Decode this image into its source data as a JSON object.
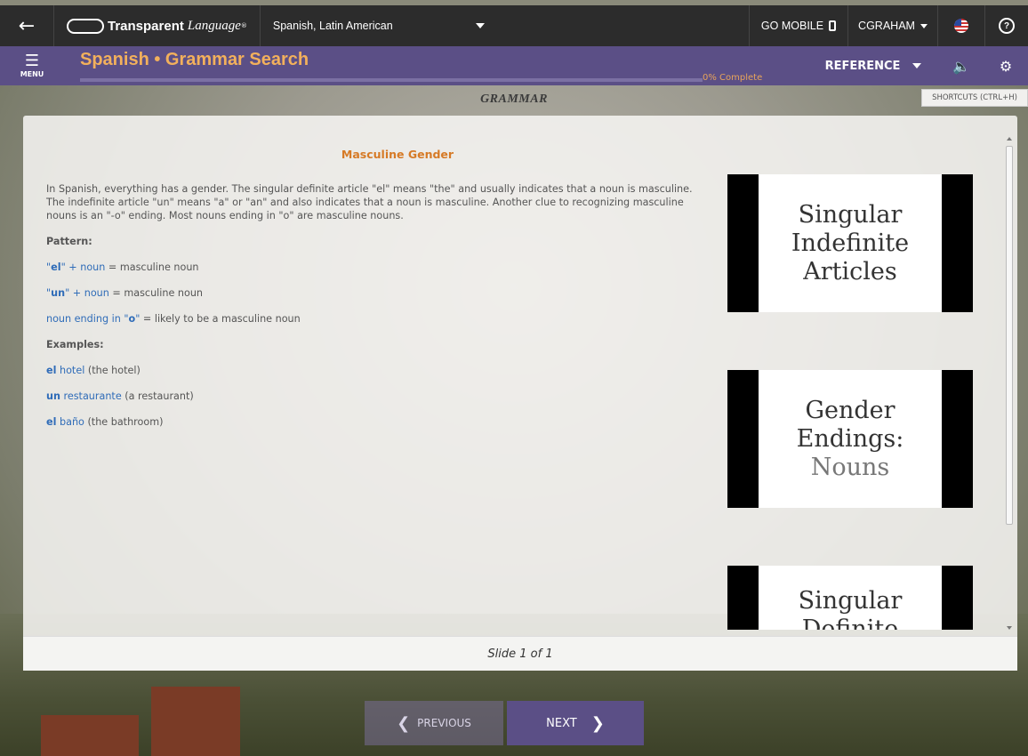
{
  "topbar": {
    "brand_bold": "Transparent",
    "brand_italic": "Language",
    "brand_mark": "®",
    "language": "Spanish, Latin American",
    "go_mobile": "GO MOBILE",
    "user": "CGRAHAM",
    "help_glyph": "?"
  },
  "header": {
    "menu_label": "MENU",
    "title": "Spanish • Grammar Search",
    "progress_text": "0% Complete",
    "progress_percent": 0,
    "reference_label": "REFERENCE",
    "shortcuts_tooltip": "SHORTCUTS (CTRL+H)"
  },
  "section": {
    "title": "GRAMMAR"
  },
  "lesson": {
    "heading": "Masculine Gender",
    "intro": "In Spanish, everything has a gender. The singular definite article \"el\" means \"the\" and usually indicates that a noun is masculine. The indefinite article \"un\" means \"a\" or \"an\" and also indicates that a noun is masculine. Another clue to recognizing masculine nouns is an \"-o\" ending. Most nouns ending in \"o\" are masculine nouns.",
    "pattern_label": "Pattern:",
    "pattern1_a": "\"",
    "pattern1_b": "el",
    "pattern1_c": "\" + noun",
    "pattern1_d": " = masculine noun",
    "pattern2_a": "\"",
    "pattern2_b": "un",
    "pattern2_c": "\" + noun",
    "pattern2_d": " = masculine noun",
    "pattern3_a": "noun ending in \"",
    "pattern3_b": "o",
    "pattern3_c": "\"",
    "pattern3_d": " = likely to be a masculine noun",
    "examples_label": "Examples:",
    "ex1_art": "el",
    "ex1_noun": " hotel",
    "ex1_trans": " (the hotel)",
    "ex2_art": "un",
    "ex2_noun": " restaurante",
    "ex2_trans": " (a restaurant)",
    "ex3_art": "el",
    "ex3_noun": " baño",
    "ex3_trans": " (the bathroom)"
  },
  "cards": [
    {
      "line1": "Singular",
      "line2": "Indefinite",
      "line3": "Articles"
    },
    {
      "line1": "Gender",
      "line2": "Endings:",
      "line3": "Nouns"
    },
    {
      "line1": "Singular",
      "line2": "Definite"
    }
  ],
  "footer": {
    "slide_text": "Slide 1 of 1"
  },
  "nav": {
    "previous": "PREVIOUS",
    "next": "NEXT"
  },
  "colors": {
    "purple": "#5b4f86",
    "orange": "#d67a26",
    "title_orange": "#f2b05c",
    "link_blue": "#2f6cb8",
    "topbar": "#2c2c2c"
  }
}
